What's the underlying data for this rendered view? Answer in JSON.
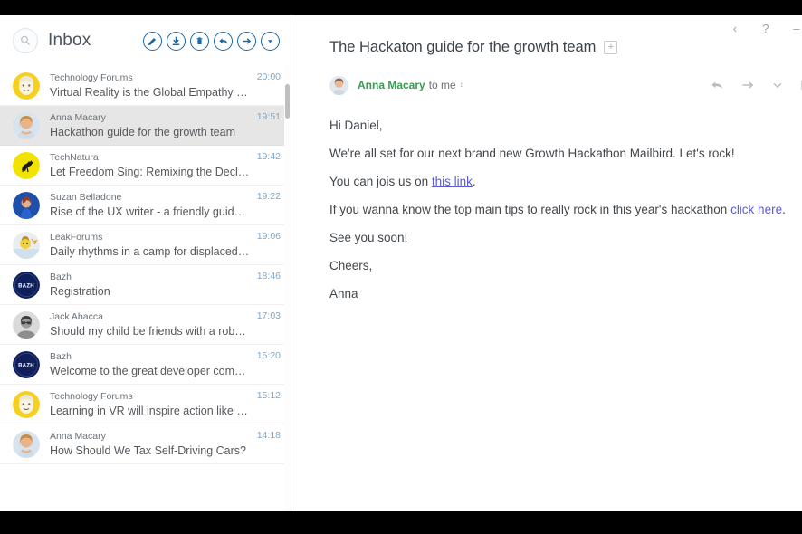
{
  "list_header": {
    "title": "Inbox",
    "search_icon": "search-icon",
    "actions": [
      {
        "name": "compose-button",
        "icon": "compose-icon",
        "label": "Compose"
      },
      {
        "name": "archive-button",
        "icon": "download-icon",
        "label": "Archive"
      },
      {
        "name": "delete-button",
        "icon": "trash-icon",
        "label": "Delete"
      },
      {
        "name": "reply-button",
        "icon": "reply-arrow-icon",
        "label": "Reply"
      },
      {
        "name": "forward-button",
        "icon": "forward-arrow-icon",
        "label": "Forward"
      },
      {
        "name": "more-button",
        "icon": "chevron-down-icon",
        "label": "More"
      }
    ]
  },
  "messages": [
    {
      "sender": "Technology Forums",
      "subject": "Virtual Reality is the Global Empathy Ma…",
      "time": "20:00",
      "avatar": "face-yellow",
      "selected": false
    },
    {
      "sender": "Anna Macary",
      "subject": "Hackathon guide for the growth team",
      "time": "19:51",
      "avatar": "anna",
      "selected": true
    },
    {
      "sender": "TechNatura",
      "subject": "Let Freedom Sing: Remixing the Declarati…",
      "time": "19:42",
      "avatar": "deer-yellow",
      "selected": false
    },
    {
      "sender": "Suzan Belladone",
      "subject": "Rise of the UX writer - a friendly guide of…",
      "time": "19:22",
      "avatar": "suzan",
      "selected": false
    },
    {
      "sender": "LeakForums",
      "subject": "Daily rhythms in a camp for displaced pe…",
      "time": "19:06",
      "avatar": "leak",
      "selected": false
    },
    {
      "sender": "Bazh",
      "subject": "Registration",
      "time": "18:46",
      "avatar": "bazh",
      "selected": false
    },
    {
      "sender": "Jack Abacca",
      "subject": "Should my child be friends with a robot…",
      "time": "17:03",
      "avatar": "jack",
      "selected": false
    },
    {
      "sender": "Bazh",
      "subject": "Welcome to the great developer commu…",
      "time": "15:20",
      "avatar": "bazh",
      "selected": false
    },
    {
      "sender": "Technology Forums",
      "subject": "Learning in VR will inspire action like nev…",
      "time": "15:12",
      "avatar": "face-yellow",
      "selected": false
    },
    {
      "sender": "Anna Macary",
      "subject": "How Should We Tax Self-Driving Cars?",
      "time": "14:18",
      "avatar": "anna",
      "selected": false
    }
  ],
  "window_controls": [
    {
      "name": "back-button",
      "glyph": "‹",
      "label": "Back"
    },
    {
      "name": "help-button",
      "glyph": "?",
      "label": "Help"
    },
    {
      "name": "minimize-button",
      "glyph": "–",
      "label": "Minimize"
    }
  ],
  "reading_pane": {
    "subject": "The Hackaton guide for the growth team",
    "add_tag_glyph": "+",
    "sender_name": "Anna Macary",
    "recipient": "to me",
    "details_caret": "↕",
    "actions": [
      {
        "name": "reply-action",
        "icon": "reply-arrow-icon",
        "label": "Reply"
      },
      {
        "name": "forward-action",
        "icon": "forward-arrow-icon",
        "label": "Forward"
      },
      {
        "name": "more-action",
        "icon": "chevron-down-icon",
        "label": "More"
      },
      {
        "name": "overflow-action",
        "icon": "vertical-bar-icon",
        "label": "More options"
      }
    ]
  },
  "body": {
    "greeting": "Hi Daniel,",
    "p1": "We're all set for our next brand new Growth Hackathon Mailbird. Let's rock!",
    "p2_pre": "You can jois us on ",
    "p2_link": "this link",
    "p2_post": ".",
    "p3_pre": "If you wanna know the top main tips to really rock in this year's hackathon ",
    "p3_link": "click here",
    "p3_post": ".",
    "p4": "See you soon!",
    "p5": "Cheers,",
    "p6": "Anna"
  },
  "colors": {
    "accent_blue": "#1569b0",
    "sender_green": "#3a9a52",
    "link_purple": "#5b5bd6",
    "time_blue": "#7ea7cd",
    "selected_row": "#e6e6e6"
  }
}
